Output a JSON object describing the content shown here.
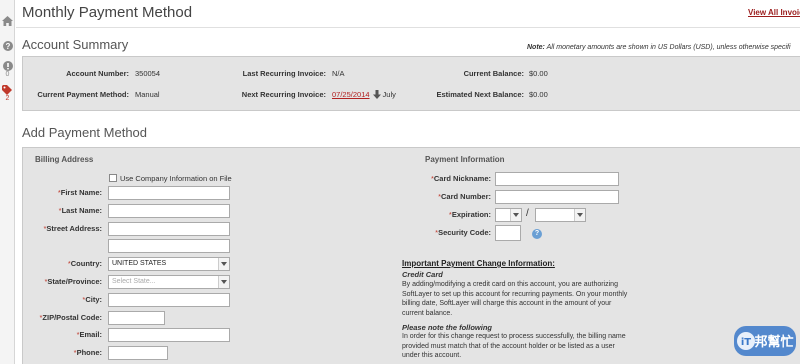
{
  "header": {
    "title": "Monthly Payment Method",
    "view_all_link": "View All Invoic"
  },
  "rail": {
    "items": [
      {
        "icon": "home-icon"
      },
      {
        "icon": "help-circle-icon"
      },
      {
        "icon": "alert-icon",
        "count": "0"
      },
      {
        "icon": "tag-icon",
        "count": "2"
      }
    ]
  },
  "account_summary": {
    "title": "Account Summary",
    "note_label": "Note:",
    "note_text": " All monetary amounts are shown in US Dollars (USD), unless otherwise specifi",
    "fields": {
      "account_number_label": "Account Number:",
      "account_number_value": "350054",
      "last_invoice_label": "Last Recurring Invoice:",
      "last_invoice_value": "N/A",
      "current_balance_label": "Current Balance:",
      "current_balance_value": "$0.00",
      "payment_method_label": "Current Payment Method:",
      "payment_method_value": "Manual",
      "next_invoice_label": "Next Recurring Invoice:",
      "next_invoice_date": "07/25/2014",
      "next_invoice_month": "July",
      "estimated_balance_label": "Estimated Next Balance:",
      "estimated_balance_value": "$0.00"
    }
  },
  "add_payment": {
    "title": "Add Payment Method",
    "billing": {
      "heading": "Billing Address",
      "use_company_label": "Use Company Information on File",
      "first_name_label": "First Name:",
      "last_name_label": "Last Name:",
      "street_label": "Street Address:",
      "country_label": "Country:",
      "country_value": "UNITED STATES",
      "state_label": "State/Province:",
      "state_placeholder": "Select State...",
      "city_label": "City:",
      "zip_label": "ZIP/Postal Code:",
      "email_label": "Email:",
      "phone_label": "Phone:"
    },
    "payment": {
      "heading": "Payment Information",
      "nickname_label": "Card Nickname:",
      "card_number_label": "Card Number:",
      "expiration_label": "Expiration:",
      "expiration_separator": "/",
      "security_code_label": "Security Code:",
      "help_glyph": "?"
    },
    "info": {
      "heading": "Important Payment Change Information:",
      "credit_card_title": "Credit Card",
      "credit_card_text": "By adding/modifying a credit card on this account, you are authorizing SoftLayer to set up this account for recurring payments. On your monthly billing date, SoftLayer will charge this account in the amount of your current balance.",
      "note_title": "Please note the following",
      "note_text": "In order for this change request to process successfully, the billing name provided must match that of the account holder or be listed as a user under this account."
    }
  },
  "colors": {
    "accent_red": "#b22222",
    "panel_bg": "#e4e4e4",
    "required_star": "#c0392b"
  },
  "watermark": {
    "brand_mark": "iT邦",
    "brand_text": "幫忙"
  }
}
